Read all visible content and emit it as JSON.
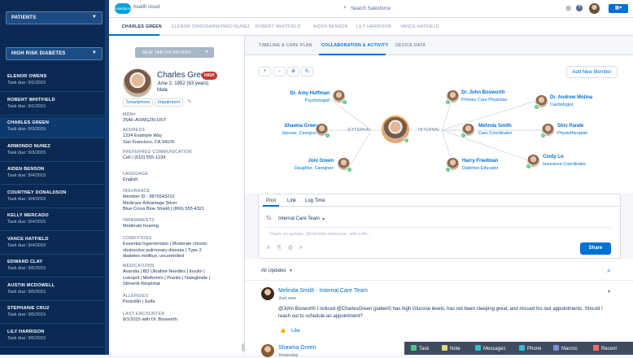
{
  "sidebar": {
    "patients_select": "PATIENTS",
    "filter_select": "HIGH RISK DIABETES",
    "patients": [
      {
        "name": "ELENOR OWENS",
        "task": "Task due: 9/1/2015"
      },
      {
        "name": "ROBERT WHITFIELD",
        "task": "Task due: 9/1/2015"
      },
      {
        "name": "CHARLES GREEN",
        "task": "Task due: 9/3/2015"
      },
      {
        "name": "ARMONDO NUNEZ",
        "task": "Task due: 9/3/2015"
      },
      {
        "name": "AIDEN BENSON",
        "task": "Task due: 9/4/2015"
      },
      {
        "name": "COURTNEY DONALDSON",
        "task": "Task due: 9/4/2015"
      },
      {
        "name": "KELLY MERCADO",
        "task": "Task due: 9/4/2015"
      },
      {
        "name": "VANCE HATFIELD",
        "task": "Task due: 9/4/2015"
      },
      {
        "name": "EDWARD CLAY",
        "task": "Task due: 9/5/2015"
      },
      {
        "name": "AUSTIN MCDOWELL",
        "task": "Task due: 9/5/2015"
      },
      {
        "name": "STEPHANIE CRUZ",
        "task": "Task due: 9/5/2015"
      },
      {
        "name": "LILY HARRISON",
        "task": "Task due: 9/5/2015"
      }
    ]
  },
  "topbar": {
    "logo": "salesforce",
    "app": "health cloud",
    "search_placeholder": "Search Salesforce"
  },
  "patient_tabs": [
    "CHARLES GREEN",
    "ELENOR OWENS",
    "ARMONDO NUNEZ",
    "ROBERT WHITFIELD",
    "AIDEN BENSON",
    "LILY HARRISON",
    "VANCE HATFIELD"
  ],
  "new_tab": "NEW TAB ON PATIENT...",
  "patient": {
    "name": "Charles Green",
    "risk": "HIGH",
    "dob": "June 2, 1952 (63 years)",
    "gender": "Male",
    "tags": [
      "Smartphone",
      "Impairment"
    ],
    "fields": [
      {
        "label": "MRN#",
        "value": "25AF-ASWGZN-OST"
      },
      {
        "label": "ADDRESS",
        "value": "1234 Example Way\nSan Francisco, CA 94105"
      },
      {
        "label": "PREFERRED COMMUNICATION",
        "value": "Cell | (510) 555-1234"
      },
      {
        "label": "LANGUAGE",
        "value": "English"
      },
      {
        "label": "INSURANCE",
        "value": "Member ID : 9876543210\nMedicare Advantage Silver\nBlue Cross Blue Shield | (866) 555-4321"
      },
      {
        "label": "IMPAIRMENTS",
        "value": "Moderate hearing"
      },
      {
        "label": "CONDITIONS",
        "value": "Essential hypertension | Moderate chronic\nobstructive pulmonary disease | Type 2\ndiabetes mellitus, uncontrolled"
      },
      {
        "label": "MEDICATIONS",
        "value": "Avandia | BD Ultrafine Needles | Insulin |\nLisinipril | Metformin | Pranlin | Nateglinide |\nStriverdi Respimat"
      },
      {
        "label": "ALLERGIES",
        "value": "Penicillin | Sulfa"
      },
      {
        "label": "LAST ENCOUNTER",
        "value": "8/1/2015 with Dr. Bosworth"
      }
    ]
  },
  "subtabs": [
    "TIMELINE & CARE PLAN",
    "COLLABORATION & ACTIVITY",
    "DEVICE DATA"
  ],
  "graph": {
    "add_member": "Add New Member",
    "external": "EXTERNAL",
    "internal": "INTERNAL",
    "members": [
      {
        "name": "Dr. Amy Huffman",
        "role": "Psychologist"
      },
      {
        "name": "Shawna Green",
        "role": "Spouse, Caregiver"
      },
      {
        "name": "Joni Green",
        "role": "Daughter, Caregiver"
      },
      {
        "name": "Dr. John Bosworth",
        "role": "Primary Care Physician"
      },
      {
        "name": "Dr. Andrew Molina",
        "role": "Cardiologist"
      },
      {
        "name": "Melinda Smith",
        "role": "Care Coordinator"
      },
      {
        "name": "Shiv Pande",
        "role": "Physiotherapist"
      },
      {
        "name": "Harry Friedman",
        "role": "Diabetes Educator"
      },
      {
        "name": "Cindy Lo",
        "role": "Insurance Coordinator"
      }
    ]
  },
  "publisher": {
    "tabs": [
      "Post",
      "Link",
      "Log Time"
    ],
    "to_label": "To",
    "to_value": "Internal Care Team",
    "placeholder": "Share an update, @mention someone, add a file...",
    "share": "Share"
  },
  "feed": {
    "filter": "All Updates",
    "post": {
      "author": "Melinda Smith - Internal Care Team",
      "time": "Just now",
      "body": "@John Bosworth I noticed @CharlesGreen (patient) has high Glucose levels, has not been sleeping great, and missed his last appointments. Should I reach out to schedule an appointment?",
      "like": "Like"
    },
    "next_author": "Shawna Green",
    "next_time": "Yesterday"
  },
  "bottombar": [
    "Task",
    "Note",
    "Messages",
    "Phone",
    "Macros",
    "Recent"
  ],
  "colors": {
    "accent": "#0070d2",
    "sidebar": "#0a2a53",
    "success": "#4bca81",
    "high": "#c23934"
  }
}
